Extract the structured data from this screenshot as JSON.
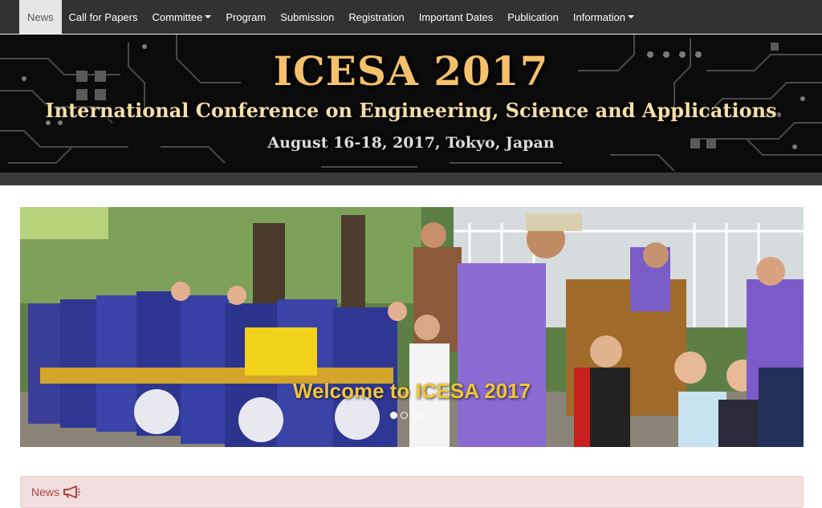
{
  "nav": {
    "items": [
      {
        "label": "News",
        "active": true
      },
      {
        "label": "Call for Papers"
      },
      {
        "label": "Committee",
        "dropdown": true
      },
      {
        "label": "Program"
      },
      {
        "label": "Submission"
      },
      {
        "label": "Registration"
      },
      {
        "label": "Important Dates"
      },
      {
        "label": "Publication"
      },
      {
        "label": "Information",
        "dropdown": true
      }
    ]
  },
  "banner": {
    "title": "ICESA 2017",
    "subtitle": "International Conference on Engineering, Science and Applications",
    "date": "August 16-18, 2017, Tokyo, Japan"
  },
  "carousel": {
    "caption": "Welcome to ICESA 2017",
    "slide_count": 4,
    "active_slide": 1
  },
  "news": {
    "heading": "News",
    "icon": "megaphone-icon"
  },
  "colors": {
    "navbar_bg": "#323232",
    "nav_active_bg": "#e6e6e6",
    "banner_title": "#f4c06a",
    "caption": "#f0c53a",
    "news_bg": "#f2dede",
    "news_text": "#a94442"
  }
}
